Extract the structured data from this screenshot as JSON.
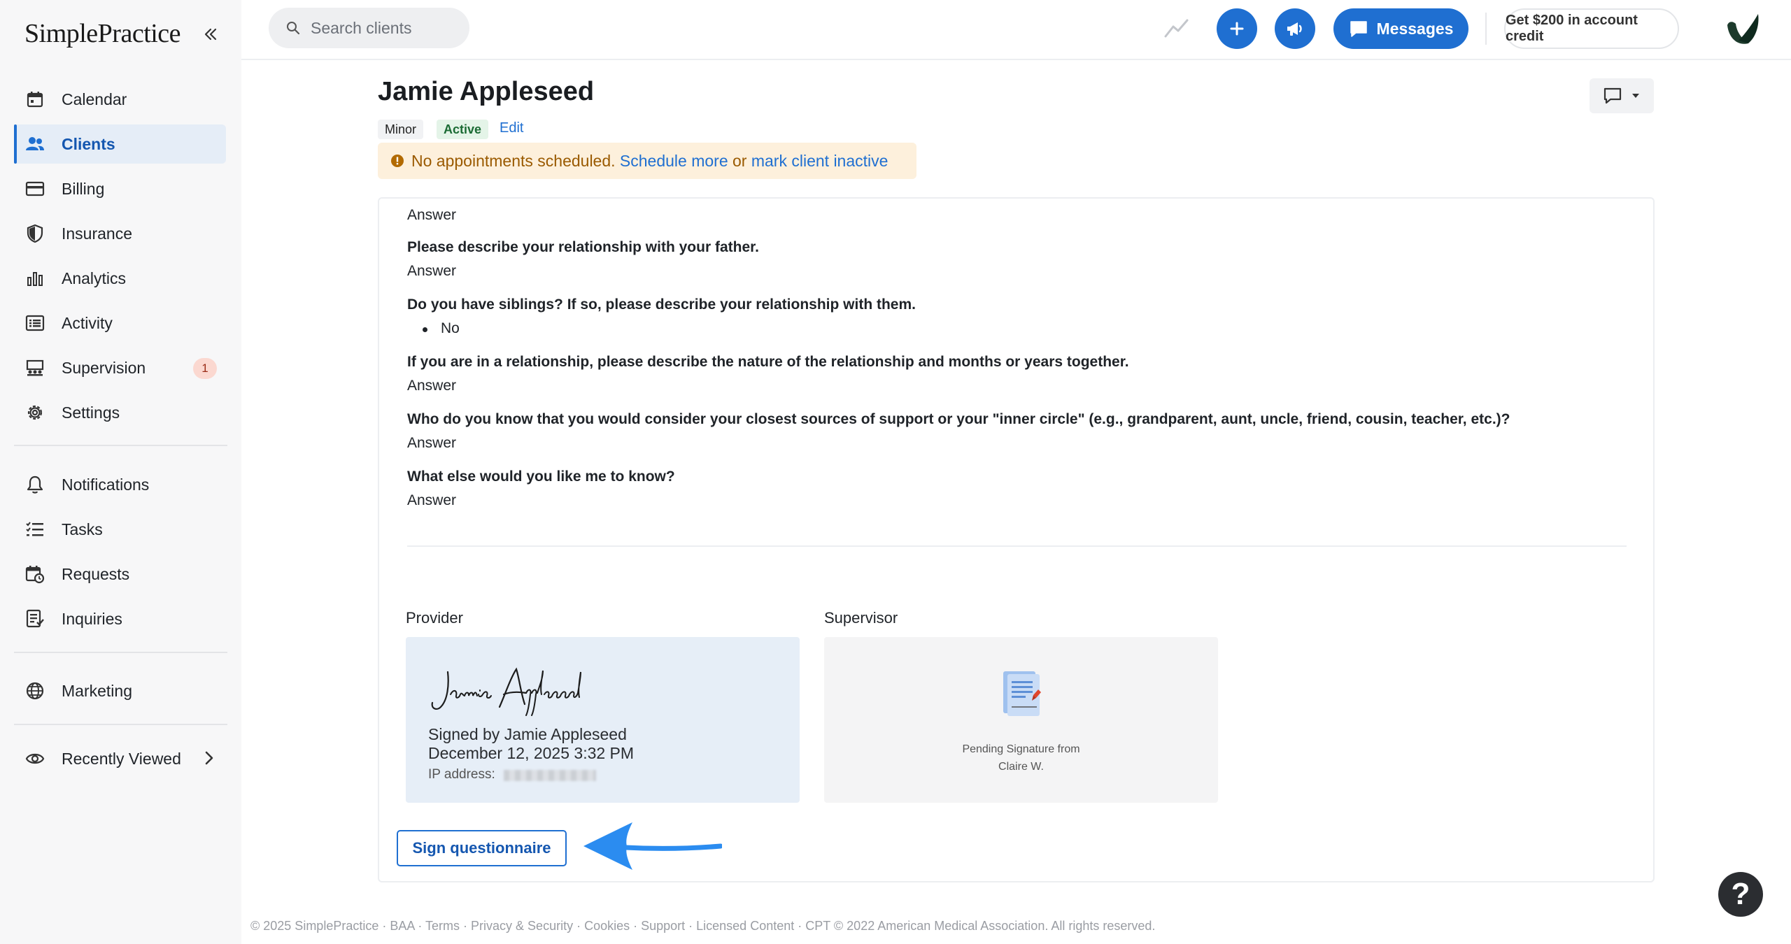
{
  "app": {
    "logo_text": "SimplePractice"
  },
  "sidebar": {
    "items": [
      {
        "label": "Calendar"
      },
      {
        "label": "Clients"
      },
      {
        "label": "Billing"
      },
      {
        "label": "Insurance"
      },
      {
        "label": "Analytics"
      },
      {
        "label": "Activity"
      },
      {
        "label": "Supervision",
        "badge": "1"
      },
      {
        "label": "Settings"
      },
      {
        "label": "Notifications"
      },
      {
        "label": "Tasks"
      },
      {
        "label": "Requests"
      },
      {
        "label": "Inquiries"
      },
      {
        "label": "Marketing"
      },
      {
        "label": "Recently Viewed"
      }
    ],
    "active": "Clients"
  },
  "topbar": {
    "search_placeholder": "Search clients",
    "messages_label": "Messages",
    "credit_label": "Get $200 in account credit"
  },
  "client": {
    "name": "Jamie Appleseed",
    "tags": [
      "Minor",
      "Active"
    ],
    "edit_label": "Edit"
  },
  "alert": {
    "text": "No appointments scheduled. ",
    "schedule_link": "Schedule more",
    "or_text": " or ",
    "inactive_link": "mark client inactive"
  },
  "questionnaire": {
    "first_answer": "Answer",
    "items": [
      {
        "question": "Please describe your relationship with your father.",
        "answer": "Answer"
      },
      {
        "question": "Do you have siblings? If so, please describe your relationship with them.",
        "answer": "No"
      },
      {
        "question": "If you are in a relationship, please describe the nature of the relationship and months or years together.",
        "answer": "Answer"
      },
      {
        "question": "Who do you know that you would consider your closest sources of support or your \"inner circle\" (e.g., grandparent, aunt, uncle, friend, cousin, teacher, etc.)?",
        "answer": "Answer"
      },
      {
        "question": "What else would you like me to know?",
        "answer": "Answer"
      }
    ]
  },
  "signatures": {
    "provider_label": "Provider",
    "signature_script": "Jamie Appleseed",
    "signed_by": "Signed by Jamie Appleseed",
    "signed_date": "December 12, 2025 3:32 PM",
    "ip_label": "IP address:",
    "supervisor_label": "Supervisor",
    "pending_line1": "Pending Signature from",
    "pending_line2": "Claire W."
  },
  "actions": {
    "sign_label": "Sign questionnaire"
  },
  "footer": {
    "text": "© 2025 SimplePractice · BAA · Terms · Privacy & Security · Cookies · Support · Licensed Content · CPT © 2022 American Medical Association. All rights reserved."
  },
  "help": {
    "label": "?"
  },
  "colors": {
    "accent": "#1f6fd1",
    "active_tag_bg": "#e4f4e8",
    "alert_bg": "#fdf0dc",
    "badge_bg": "#fbd8d0",
    "provider_box_bg": "#e6eef7",
    "annotation_arrow": "#2b8cf0"
  }
}
